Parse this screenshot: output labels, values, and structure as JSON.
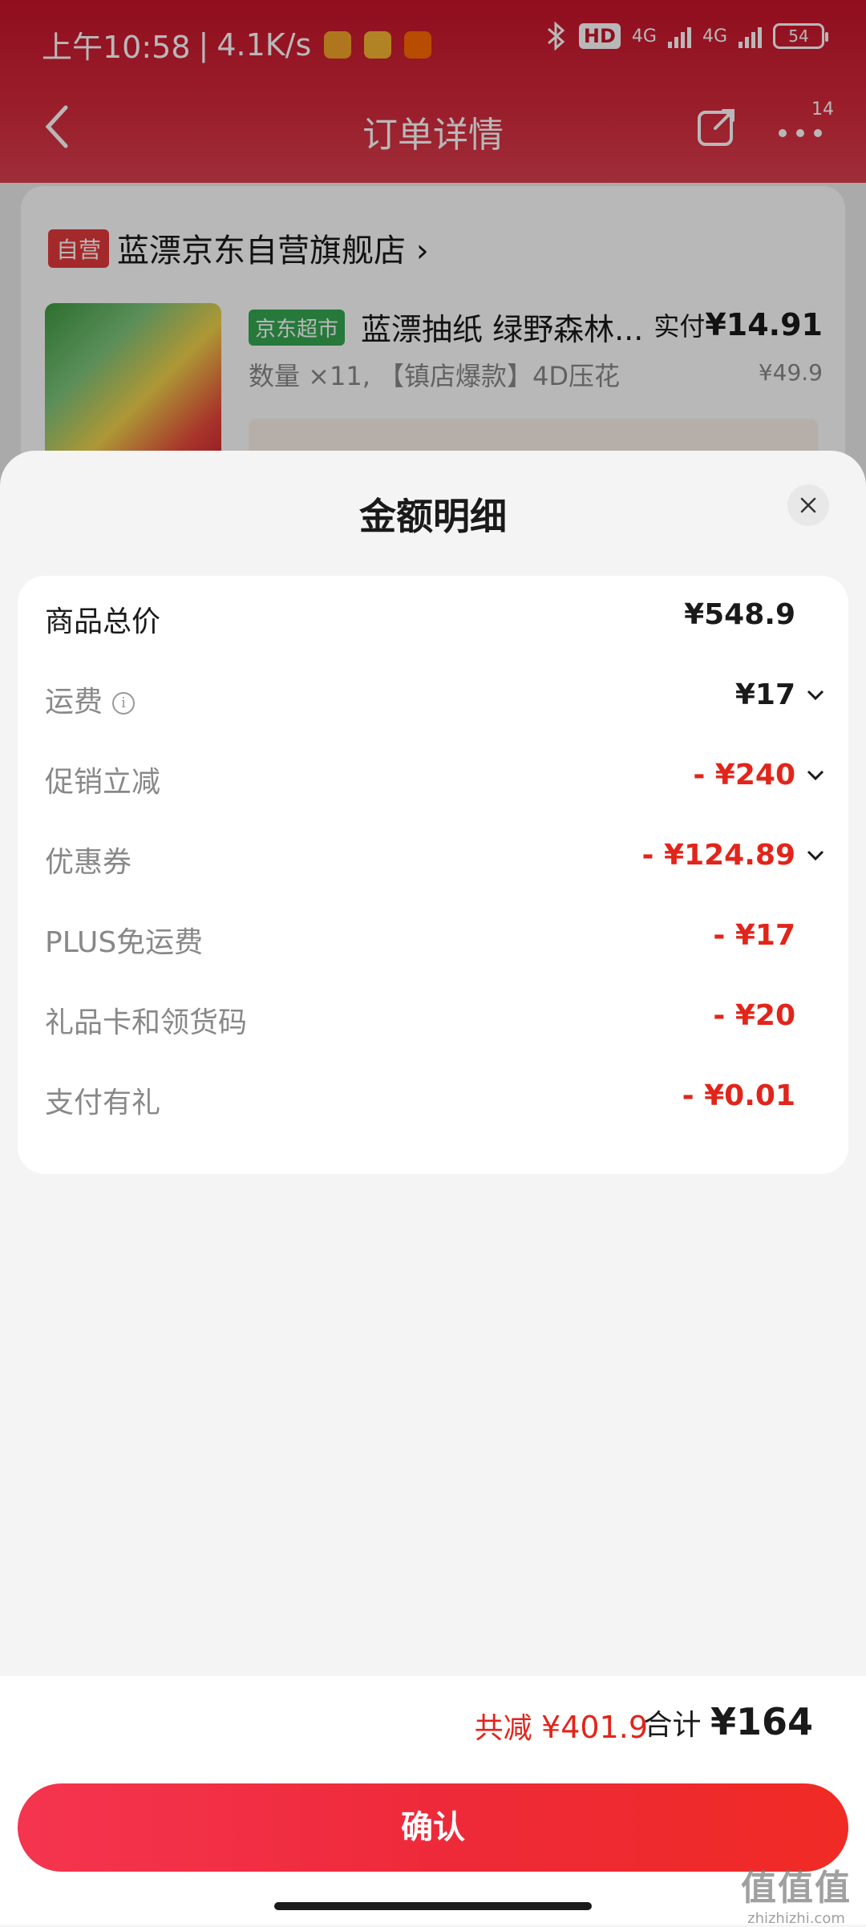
{
  "status_bar": {
    "time": "上午10:58",
    "speed": "4.1K/s",
    "hd_label": "HD",
    "network_1": "4G",
    "network_2": "4G",
    "battery": "54"
  },
  "nav": {
    "title": "订单详情",
    "more_count": "14"
  },
  "store": {
    "self_badge": "自营",
    "name": "蓝漂京东自营旗舰店",
    "product": {
      "market_badge": "京东超市",
      "name": "蓝漂抽纸 绿野森林...",
      "paid_label": "实付",
      "paid_amount": "¥14.91",
      "spec": "数量 ×11, 【镇店爆款】4D压花",
      "original_price": "¥49.9"
    }
  },
  "sheet": {
    "title": "金额明细",
    "rows": [
      {
        "label": "商品总价",
        "value": "¥548.9"
      },
      {
        "label": "运费",
        "value": "¥17"
      },
      {
        "label": "促销立减",
        "value": "- ¥240"
      },
      {
        "label": "优惠券",
        "value": "- ¥124.89"
      },
      {
        "label": "PLUS免运费",
        "value": "- ¥17"
      },
      {
        "label": "礼品卡和领货码",
        "value": "- ¥20"
      },
      {
        "label": "支付有礼",
        "value": "- ¥0.01"
      }
    ]
  },
  "footer": {
    "saved_label": "共减",
    "saved_amount": "¥401.9",
    "total_label": "合计",
    "total_amount": "¥164",
    "confirm_label": "确认"
  },
  "watermark": {
    "top": "值值值",
    "bottom": "zhizhizhi.com"
  },
  "colors": {
    "accent_red": "#e1251b",
    "header_red": "#c8142a",
    "button_red": "#f5344f"
  }
}
